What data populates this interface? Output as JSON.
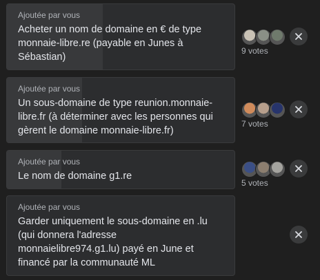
{
  "options": [
    {
      "added_by": "Ajoutée par vous",
      "text": "Acheter un nom de domaine en € de type\nmonnaie-libre.re (payable en Junes à\nSébastian)",
      "vote_share": 0.42,
      "votes_label": "9 votes",
      "avatars": [
        {
          "icon": "avatar-photo",
          "color": "#c9c2b5"
        },
        {
          "icon": "avatar-photo",
          "color": "#8a8f86"
        },
        {
          "icon": "avatar-photo",
          "color": "#6f7a6c"
        }
      ],
      "remove_icon": "close-icon"
    },
    {
      "added_by": "Ajoutée par vous",
      "text": "Un sous-domaine de type reunion.monnaie-\nlibre.fr (à déterminer avec les personnes qui\ngèrent le domaine monnaie-libre.fr)",
      "vote_share": 0.33,
      "votes_label": "7 votes",
      "avatars": [
        {
          "icon": "avatar-photo",
          "color": "#d08b5b"
        },
        {
          "icon": "avatar-photo",
          "color": "#b79f8c"
        },
        {
          "icon": "avatar-photo",
          "color": "#27346b"
        }
      ],
      "remove_icon": "close-icon"
    },
    {
      "added_by": "Ajoutée par vous",
      "text": "Le nom de domaine g1.re",
      "vote_share": 0.24,
      "votes_label": "5 votes",
      "avatars": [
        {
          "icon": "avatar-photo",
          "color": "#3b4f86"
        },
        {
          "icon": "avatar-photo",
          "color": "#8c7e6f"
        },
        {
          "icon": "avatar-photo",
          "color": "#a4a39e"
        }
      ],
      "remove_icon": "close-icon"
    },
    {
      "added_by": "Ajoutée par vous",
      "text": "Garder uniquement le sous-domaine en .lu\n(qui donnera l'adresse\nmonnaielibre974.g1.lu) payé en June et\nfinancé par la communauté ML",
      "vote_share": 0,
      "votes_label": "",
      "avatars": [],
      "remove_icon": "close-icon"
    }
  ]
}
